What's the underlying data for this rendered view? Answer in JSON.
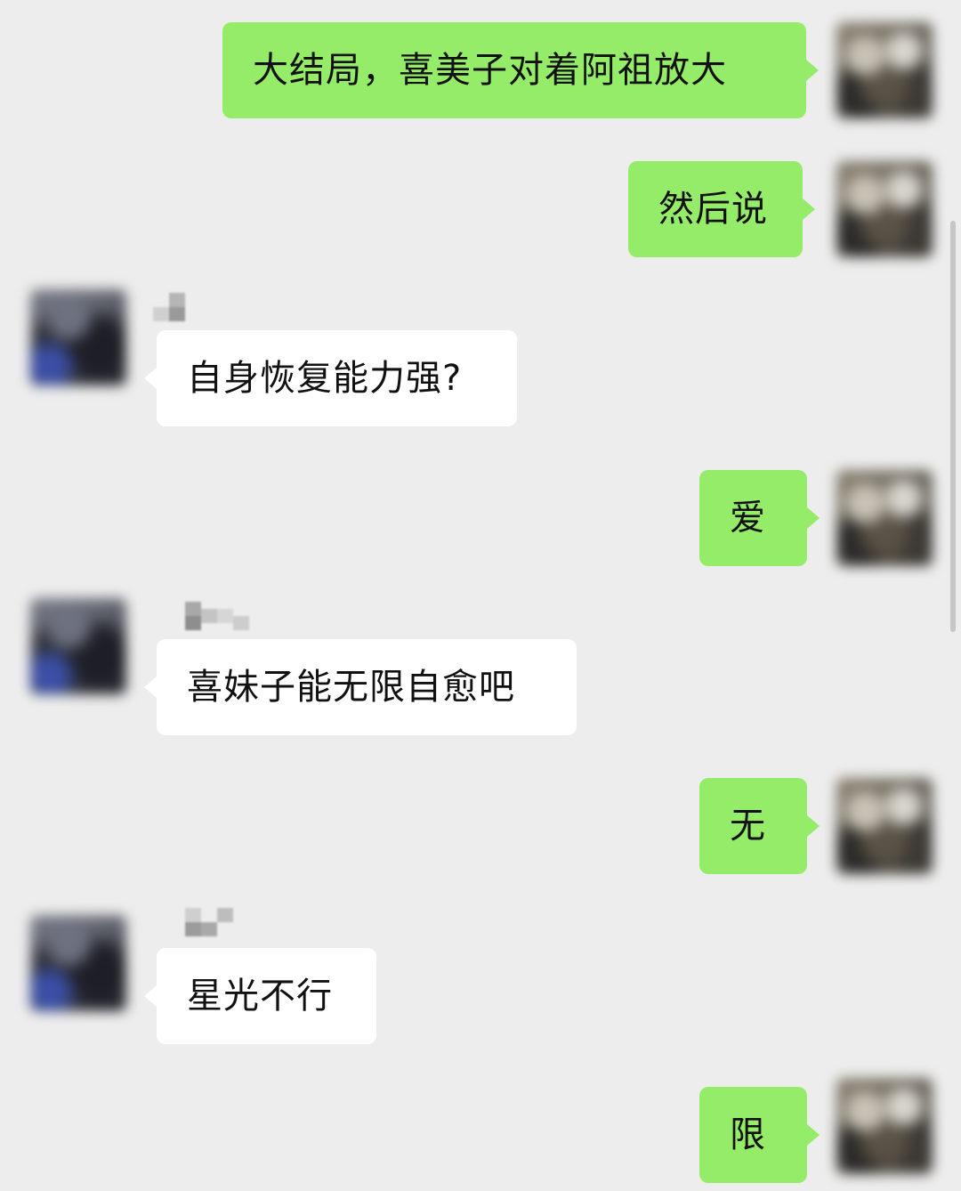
{
  "conversation": {
    "messages": [
      {
        "sender": "me",
        "text": "大结局，喜美子对着阿祖放大"
      },
      {
        "sender": "me",
        "text": "然后说"
      },
      {
        "sender": "other",
        "text": "自身恢复能力强?"
      },
      {
        "sender": "me",
        "text": "爱"
      },
      {
        "sender": "other",
        "text": "喜妹子能无限自愈吧"
      },
      {
        "sender": "me",
        "text": "无"
      },
      {
        "sender": "other",
        "text": "星光不行"
      },
      {
        "sender": "me",
        "text": "限"
      }
    ]
  },
  "colors": {
    "background": "#ededed",
    "sent_bubble": "#95ec69",
    "received_bubble": "#ffffff",
    "text": "#111111"
  }
}
